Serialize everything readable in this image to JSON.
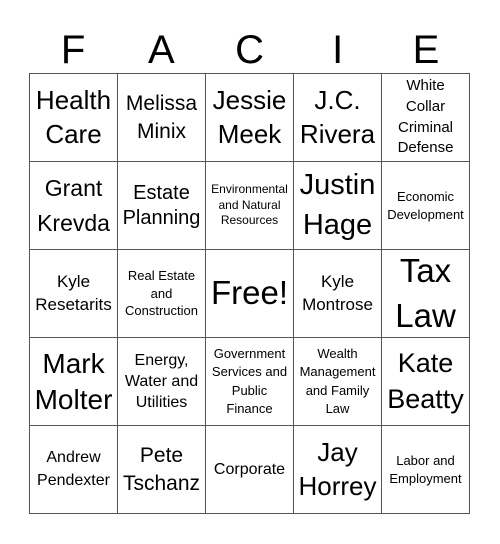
{
  "header": {
    "letters": [
      "F",
      "A",
      "C",
      "I",
      "E"
    ]
  },
  "board": {
    "rows": [
      [
        {
          "text": "Health Care",
          "size": "lg"
        },
        {
          "text": "Melissa Minix",
          "size": "md"
        },
        {
          "text": "Jessie Meek",
          "size": "lg"
        },
        {
          "text": "J.C. Rivera",
          "size": "lg"
        },
        {
          "text": "White Collar Criminal Defense",
          "size": "xs"
        }
      ],
      [
        {
          "text": "Grant Krevda",
          "size": "md2"
        },
        {
          "text": "Estate Planning",
          "size": "md"
        },
        {
          "text": "Environmental and Natural Resources",
          "size": "xxs"
        },
        {
          "text": "Justin Hage",
          "size": "xl"
        },
        {
          "text": "Economic Development",
          "size": "xs2"
        }
      ],
      [
        {
          "text": "Kyle Resetarits",
          "size": "sm"
        },
        {
          "text": "Real Estate and Construction",
          "size": "xs3"
        },
        {
          "text": "Free!",
          "size": "xl"
        },
        {
          "text": "Kyle Montrose",
          "size": "sm"
        },
        {
          "text": "Tax Law",
          "size": "xl2"
        }
      ],
      [
        {
          "text": "Mark Molter",
          "size": "lg2"
        },
        {
          "text": "Energy, Water and Utilities",
          "size": "sm"
        },
        {
          "text": "Government Services and Public Finance",
          "size": "xs3"
        },
        {
          "text": "Wealth Management and Family Law",
          "size": "xs3"
        },
        {
          "text": "Kate Beatty",
          "size": "lg2"
        }
      ],
      [
        {
          "text": "Andrew Pendexter",
          "size": "sm"
        },
        {
          "text": "Pete Tschanz",
          "size": "md"
        },
        {
          "text": "Corporate",
          "size": "sm"
        },
        {
          "text": "Jay Horrey",
          "size": "lg"
        },
        {
          "text": "Labor and Employment",
          "size": "xs3"
        }
      ]
    ]
  }
}
